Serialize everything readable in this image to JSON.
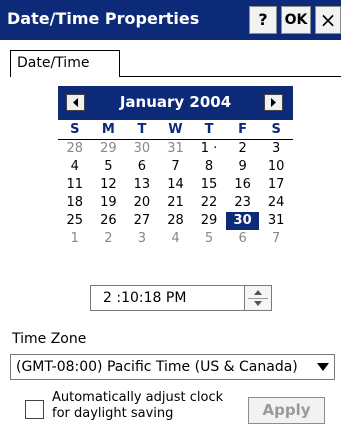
{
  "titlebar": {
    "title": "Date/Time Properties",
    "help_label": "?",
    "ok_label": "OK",
    "close_label": "×"
  },
  "tabs": [
    {
      "label": "Date/Time"
    }
  ],
  "calendar": {
    "month_label": "January 2004",
    "weekdays": [
      "S",
      "M",
      "T",
      "W",
      "T",
      "F",
      "S"
    ],
    "weeks": [
      [
        "28",
        "29",
        "30",
        "31",
        "1 ·",
        "2",
        "3"
      ],
      [
        "4",
        "5",
        "6",
        "7",
        "8",
        "9",
        "10"
      ],
      [
        "11",
        "12",
        "13",
        "14",
        "15",
        "16",
        "17"
      ],
      [
        "18",
        "19",
        "20",
        "21",
        "22",
        "23",
        "24"
      ],
      [
        "25",
        "26",
        "27",
        "28",
        "29",
        "30",
        "31"
      ],
      [
        "1",
        "2",
        "3",
        "4",
        "5",
        "6",
        "7"
      ]
    ],
    "selected_day": "30"
  },
  "time": {
    "value": "2 :10:18 PM"
  },
  "timezone": {
    "label": "Time Zone",
    "selected": "(GMT-08:00) Pacific Time (US & Canada)"
  },
  "dst": {
    "label": "Automatically adjust clock for daylight saving"
  },
  "apply_label": "Apply",
  "colors": {
    "titlebar": "#0c2a78",
    "selection": "#0c2a78"
  }
}
